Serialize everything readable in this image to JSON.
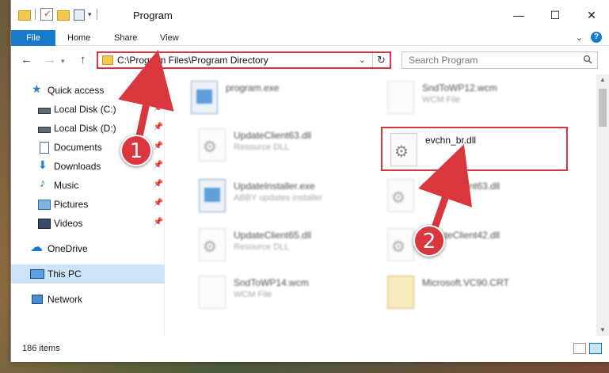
{
  "window": {
    "title": "Program",
    "controls": {
      "minimize": "—",
      "maximize": "☐",
      "close": "✕"
    }
  },
  "ribbon": {
    "tabs": {
      "file": "File",
      "home": "Home",
      "share": "Share",
      "view": "View"
    },
    "help": "?"
  },
  "navbar": {
    "address": "C:\\Program Files\\Program Directory",
    "search_placeholder": "Search Program"
  },
  "sidebar": {
    "items": [
      {
        "label": "Quick access",
        "icon": "star-icon",
        "pinned": false
      },
      {
        "label": "Local Disk (C:)",
        "icon": "drive-icon",
        "pinned": true
      },
      {
        "label": "Local Disk (D:)",
        "icon": "drive-icon",
        "pinned": true
      },
      {
        "label": "Documents",
        "icon": "documents-icon",
        "pinned": true
      },
      {
        "label": "Downloads",
        "icon": "download-icon",
        "pinned": true
      },
      {
        "label": "Music",
        "icon": "music-icon",
        "pinned": true
      },
      {
        "label": "Pictures",
        "icon": "pictures-icon",
        "pinned": true
      },
      {
        "label": "Videos",
        "icon": "videos-icon",
        "pinned": true
      },
      {
        "label": "OneDrive",
        "icon": "cloud-icon",
        "pinned": false
      },
      {
        "label": "This PC",
        "icon": "computer-icon",
        "pinned": false,
        "selected": true
      },
      {
        "label": "Network",
        "icon": "network-icon",
        "pinned": false
      }
    ]
  },
  "files": [
    {
      "name": "program.exe",
      "type": "",
      "icon": "app-icon"
    },
    {
      "name": "SndToWP12.wcm",
      "type": "WCM File",
      "icon": "document-icon"
    },
    {
      "name": "UpdateClient63.dll",
      "type": "Resource DLL",
      "icon": "dll-gear-icon"
    },
    {
      "name": "evchn_br.dll",
      "type": "",
      "icon": "dll-gear-icon",
      "highlighted": true
    },
    {
      "name": "UpdateInstaller.exe",
      "type": "ABBY updates installer",
      "icon": "app-icon"
    },
    {
      "name": "UpdateClient63.dll",
      "type": "",
      "icon": "dll-gear-icon"
    },
    {
      "name": "UpdateClient65.dll",
      "type": "Resource DLL",
      "icon": "dll-gear-icon"
    },
    {
      "name": "UpdateClient42.dll",
      "type": "",
      "icon": "dll-gear-icon"
    },
    {
      "name": "SndToWP14.wcm",
      "type": "WCM File",
      "icon": "document-icon"
    },
    {
      "name": "Microsoft.VC90.CRT",
      "type": "",
      "icon": "zip-folder-icon"
    }
  ],
  "status": {
    "item_count": "186 items"
  },
  "annotations": {
    "step1": "1",
    "step2": "2"
  },
  "colors": {
    "accent": "#1979ca",
    "highlight": "#d9363e"
  }
}
